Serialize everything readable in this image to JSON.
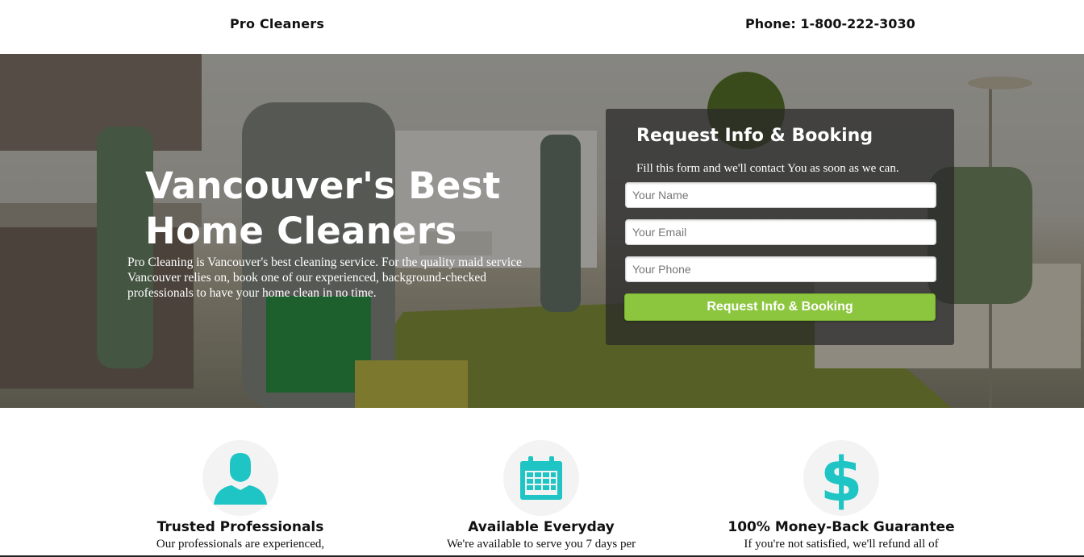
{
  "header": {
    "brand": "Pro Cleaners",
    "phone": "Phone: 1-800-222-3030"
  },
  "hero": {
    "title_line1": "Vancouver's Best",
    "title_line2": "Home Cleaners",
    "description": "Pro Cleaning is Vancouver's best cleaning service. For the quality maid service Vancouver relies on, book one of our experienced, background-checked professionals to have your home clean in no time."
  },
  "form": {
    "title": "Request Info & Booking",
    "subtitle": "Fill this form and we'll contact You as soon as we can.",
    "name_placeholder": "Your Name",
    "email_placeholder": "Your Email",
    "phone_placeholder": "Your Phone",
    "submit_label": "Request Info & Booking"
  },
  "features": [
    {
      "icon": "person-icon",
      "title": "Trusted Professionals",
      "text": "Our professionals are experienced,"
    },
    {
      "icon": "calendar-icon",
      "title": "Available Everyday",
      "text": "We're available to serve you 7 days per"
    },
    {
      "icon": "dollar-icon",
      "title": "100% Money-Back Guarantee",
      "text": "If you're not satisfied, we'll refund all of"
    }
  ],
  "colors": {
    "accent_green": "#8cc63f",
    "icon_teal": "#1fc4c4"
  }
}
